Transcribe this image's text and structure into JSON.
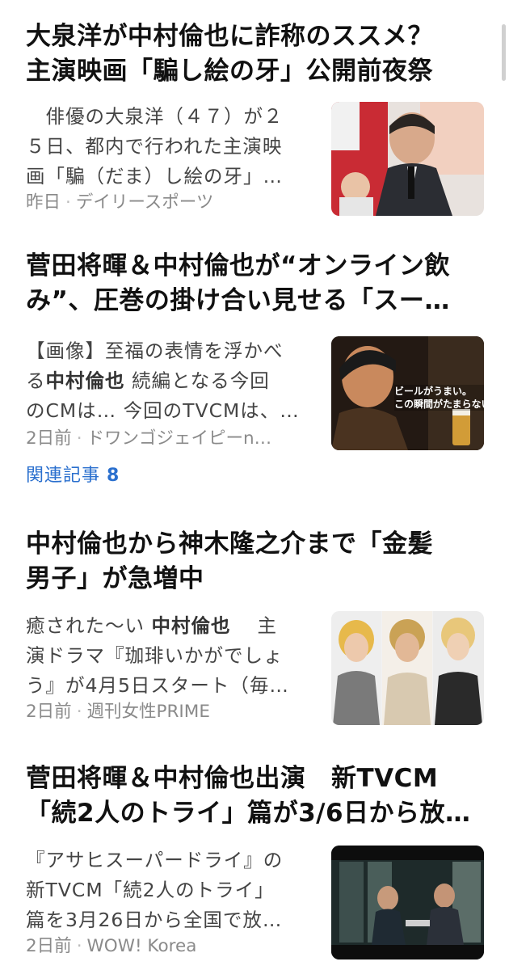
{
  "articles": [
    {
      "headline_1": "大泉洋が中村倫也に詐称のススメ？",
      "headline_2": "主演映画「騙し絵の牙」公開前夜祭",
      "snippet_lines": [
        "　俳優の大泉洋（４７）が２",
        "５日、都内で行われた主演映",
        "画「騙（だま）し絵の牙」…"
      ],
      "date": "昨日",
      "source": "デイリースポーツ",
      "thumb_icon": "photo-press-event-icon"
    },
    {
      "headline_1": "菅田将暉＆中村倫也が“オンライン飲",
      "headline_2": "み”、圧巻の掛け合い見せる「スー…",
      "snippet_line1": "【画像】至福の表情を浮かべ",
      "snippet_line2_pre": "る",
      "snippet_line2_hl": "中村倫也",
      "snippet_line2_post": " 続編となる今回",
      "snippet_line3": "のCMは… 今回のTVCMは、…",
      "date": "2日前",
      "source": "ドワンゴジェイピーn…",
      "thumb_caption_1": "ビールがうまい。",
      "thumb_caption_2": "この瞬間がたまらない",
      "related_label": "関連記事",
      "related_count": "8",
      "thumb_icon": "photo-beer-cm-icon"
    },
    {
      "headline_1": "中村倫也から神木隆之介まで「金髪",
      "headline_2": "男子」が急増中",
      "snippet_line1_pre": "癒された〜い ",
      "snippet_line1_hl": "中村倫也",
      "snippet_line1_post": "　 主",
      "snippet_line2": "演ドラマ『珈琲いかがでしょ",
      "snippet_line3": "う』が4月5日スタート（毎…",
      "date": "2日前",
      "source": "週刊女性PRIME",
      "thumb_icon": "photo-three-men-icon"
    },
    {
      "headline_1": "菅田将暉＆中村倫也出演　新TVCM",
      "headline_2": "「続2人のトライ」篇が3/6日から放…",
      "snippet_lines": [
        "『アサヒスーパードライ』の",
        "新TVCM「続2人のトライ」",
        "篇を3月26日から全国で放…"
      ],
      "date": "2日前",
      "source": "WOW! Korea",
      "thumb_icon": "photo-office-cm-icon"
    }
  ],
  "colors": {
    "headline": "#111111",
    "snippet": "#444444",
    "meta": "#8a8a8a",
    "related_link": "#2a6fce"
  }
}
